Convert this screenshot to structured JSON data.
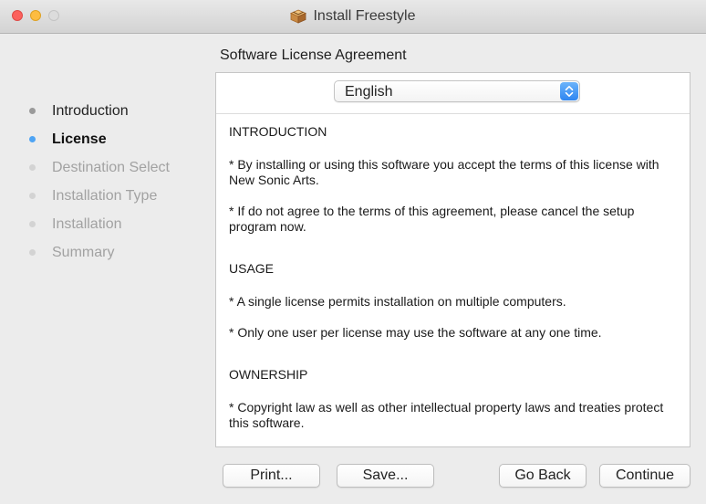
{
  "window": {
    "title": "Install Freestyle",
    "icon": "package-icon"
  },
  "sidebar": {
    "steps": [
      {
        "label": "Introduction",
        "state": "done"
      },
      {
        "label": "License",
        "state": "current"
      },
      {
        "label": "Destination Select",
        "state": "future"
      },
      {
        "label": "Installation Type",
        "state": "future"
      },
      {
        "label": "Installation",
        "state": "future"
      },
      {
        "label": "Summary",
        "state": "future"
      }
    ]
  },
  "main": {
    "section_title": "Software License Agreement",
    "language_select": {
      "value": "English"
    },
    "license": {
      "introduction_heading": "INTRODUCTION",
      "introduction_p1": "* By installing or using this software you accept the terms of this license with New Sonic Arts.",
      "introduction_p2": "* If do not agree to the terms of this agreement, please cancel the setup program now.",
      "usage_heading": "USAGE",
      "usage_p1": "* A single license permits installation on multiple computers.",
      "usage_p2": "* Only one user per license may use the software at any one time.",
      "ownership_heading": "OWNERSHIP",
      "ownership_p1": "* Copyright law as well as other intellectual property laws and treaties protect this software."
    }
  },
  "buttons": {
    "print": "Print...",
    "save": "Save...",
    "go_back": "Go Back",
    "continue": "Continue"
  },
  "colors": {
    "current_step": "#4ea4f4",
    "select_accent": "#2f86f1",
    "close": "#fc615d",
    "minimize": "#fdbc40"
  }
}
